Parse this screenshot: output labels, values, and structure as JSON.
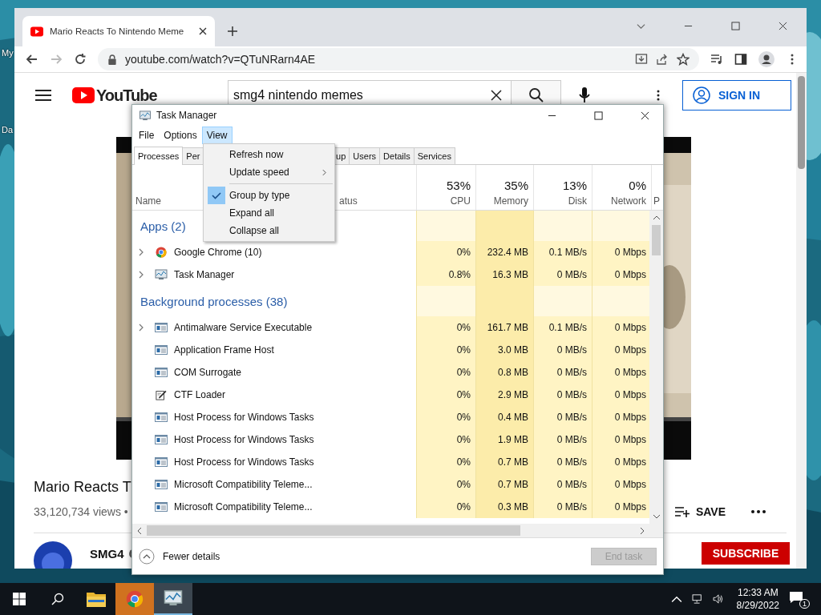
{
  "desktop": {
    "icon_labels": [
      "My",
      "Da"
    ]
  },
  "browser": {
    "tab": {
      "title": "Mario Reacts To Nintendo Meme"
    },
    "url": "youtube.com/watch?v=QTuNRarn4AE"
  },
  "youtube": {
    "logo": "YouTube",
    "search": {
      "value": "smg4 nintendo memes"
    },
    "sign_in": "SIGN IN",
    "video_title": "Mario Reacts T",
    "views": "33,120,734 views •",
    "save": "SAVE",
    "channel": "SMG4",
    "subscribe": "SUBSCRIBE"
  },
  "task_manager": {
    "title": "Task Manager",
    "menu": [
      {
        "label": "File",
        "selected": false
      },
      {
        "label": "Options",
        "selected": false
      },
      {
        "label": "View",
        "selected": true
      }
    ],
    "view_menu": [
      {
        "kind": "item",
        "label": "Refresh now",
        "checked": false
      },
      {
        "kind": "submenu",
        "label": "Update speed",
        "checked": false
      },
      {
        "kind": "separator"
      },
      {
        "kind": "item",
        "label": "Group by type",
        "checked": true
      },
      {
        "kind": "item",
        "label": "Expand all",
        "checked": false
      },
      {
        "kind": "item",
        "label": "Collapse all",
        "checked": false
      }
    ],
    "tabs": [
      {
        "label": "Processes",
        "selected": true
      },
      {
        "label": "Per",
        "selected": false
      },
      {
        "label": "up",
        "selected": false
      },
      {
        "label": "Users",
        "selected": false
      },
      {
        "label": "Details",
        "selected": false
      },
      {
        "label": "Services",
        "selected": false
      }
    ],
    "columns": [
      {
        "label": "Name"
      },
      {
        "label": "atus"
      },
      {
        "label": "CPU",
        "total": "53%"
      },
      {
        "label": "Memory",
        "total": "35%"
      },
      {
        "label": "Disk",
        "total": "13%"
      },
      {
        "label": "Network",
        "total": "0%"
      },
      {
        "label": "P"
      }
    ],
    "groups": [
      {
        "title": "Apps (2)",
        "rows": [
          {
            "name": "Google Chrome (10)",
            "expandable": true,
            "kind": "chrome",
            "cells": [
              "0%",
              "232.4 MB",
              "0.1 MB/s",
              "0 Mbps"
            ]
          },
          {
            "name": "Task Manager",
            "expandable": true,
            "kind": "taskmgr",
            "cells": [
              "0.8%",
              "16.3 MB",
              "0 MB/s",
              "0 Mbps"
            ]
          }
        ]
      },
      {
        "title": "Background processes (38)",
        "rows": [
          {
            "name": "Antimalware Service Executable",
            "expandable": true,
            "kind": "service",
            "cells": [
              "0%",
              "161.7 MB",
              "0.1 MB/s",
              "0 Mbps"
            ]
          },
          {
            "name": "Application Frame Host",
            "expandable": false,
            "kind": "service",
            "cells": [
              "0%",
              "3.0 MB",
              "0 MB/s",
              "0 Mbps"
            ]
          },
          {
            "name": "COM Surrogate",
            "expandable": false,
            "kind": "service",
            "cells": [
              "0%",
              "0.8 MB",
              "0 MB/s",
              "0 Mbps"
            ]
          },
          {
            "name": "CTF Loader",
            "expandable": false,
            "kind": "pen",
            "cells": [
              "0%",
              "2.9 MB",
              "0 MB/s",
              "0 Mbps"
            ]
          },
          {
            "name": "Host Process for Windows Tasks",
            "expandable": false,
            "kind": "service",
            "cells": [
              "0%",
              "0.4 MB",
              "0 MB/s",
              "0 Mbps"
            ]
          },
          {
            "name": "Host Process for Windows Tasks",
            "expandable": false,
            "kind": "service",
            "cells": [
              "0%",
              "1.9 MB",
              "0 MB/s",
              "0 Mbps"
            ]
          },
          {
            "name": "Host Process for Windows Tasks",
            "expandable": false,
            "kind": "service",
            "cells": [
              "0%",
              "0.7 MB",
              "0 MB/s",
              "0 Mbps"
            ]
          },
          {
            "name": "Microsoft Compatibility Teleme...",
            "expandable": false,
            "kind": "service",
            "cells": [
              "0%",
              "0.7 MB",
              "0 MB/s",
              "0 Mbps"
            ]
          },
          {
            "name": "Microsoft Compatibility Teleme...",
            "expandable": false,
            "kind": "service",
            "cells": [
              "0%",
              "0.3 MB",
              "0 MB/s",
              "0 Mbps"
            ]
          }
        ]
      }
    ],
    "fewer_details": "Fewer details",
    "end_task": {
      "label": "End task",
      "disabled": true
    }
  },
  "taskbar": {
    "apps": [
      {
        "kind": "explorer",
        "attention": false,
        "active": false
      },
      {
        "kind": "chrome",
        "attention": true,
        "active": false
      },
      {
        "kind": "taskmgr",
        "attention": false,
        "active": true
      }
    ],
    "time": "12:33 AM",
    "date": "8/29/2022",
    "notifications": "1"
  }
}
